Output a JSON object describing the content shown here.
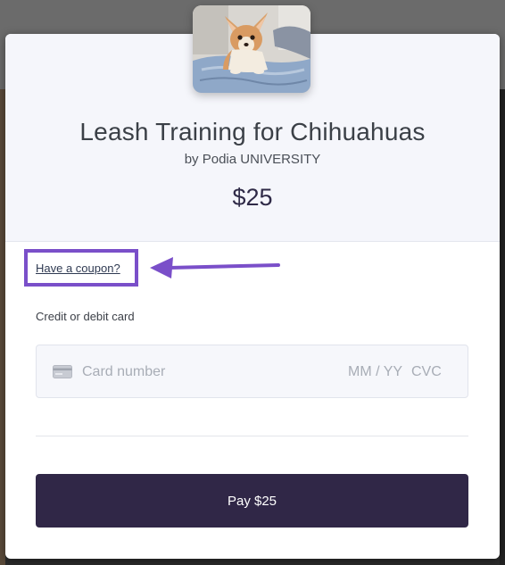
{
  "product": {
    "title": "Leash Training for Chihuahuas",
    "byline": "by Podia UNIVERSITY",
    "price": "$25"
  },
  "coupon": {
    "link_label": "Have a coupon?"
  },
  "payment": {
    "section_label": "Credit or debit card",
    "card_number_placeholder": "Card number",
    "expiry_placeholder": "MM / YY",
    "cvc_placeholder": "CVC",
    "pay_button_label": "Pay $25"
  },
  "colors": {
    "accent": "#7a4fc9",
    "button": "#302747",
    "header_bg": "#f5f6fb"
  },
  "icons": {
    "card": "credit-card-icon",
    "arrow": "arrow-left-icon"
  }
}
